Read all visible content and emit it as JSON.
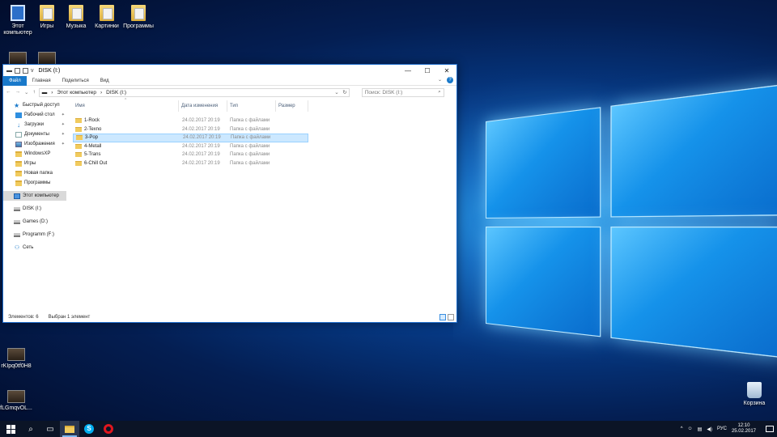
{
  "desktop": {
    "icons": [
      {
        "label": "Этот компьютер",
        "icon": "computer-icon"
      },
      {
        "label": "Игры",
        "icon": "folder-icon"
      },
      {
        "label": "Музыка",
        "icon": "folder-icon"
      },
      {
        "label": "Картинки",
        "icon": "folder-icon"
      },
      {
        "label": "Программы",
        "icon": "folder-icon"
      },
      {
        "label": "rKIpq0tf0H8",
        "icon": "image-thumbnail-icon"
      },
      {
        "label": "fLGmqvOL...",
        "icon": "image-thumbnail-icon"
      },
      {
        "label": "Корзина",
        "icon": "recycle-bin-icon"
      }
    ]
  },
  "window": {
    "title": "DISK (I:)",
    "qa_dropdown": "v",
    "controls": {
      "minimize": "—",
      "maximize": "☐",
      "close": "✕"
    },
    "ribbon_tabs": [
      "Файл",
      "Главная",
      "Поделиться",
      "Вид"
    ],
    "address": {
      "crumbs": [
        "Этот компьютер",
        "DISK (I:)"
      ],
      "separator": "›"
    },
    "search_placeholder": "Поиск: DISK (I:)",
    "sidebar": [
      {
        "label": "Быстрый доступ",
        "icon": "star-icon",
        "pinned": false
      },
      {
        "label": "Рабочий стол",
        "icon": "desktop-icon",
        "pinned": true
      },
      {
        "label": "Загрузки",
        "icon": "download-icon",
        "pinned": true
      },
      {
        "label": "Документы",
        "icon": "documents-icon",
        "pinned": true
      },
      {
        "label": "Изображения",
        "icon": "pictures-icon",
        "pinned": true
      },
      {
        "label": "WindowsXP",
        "icon": "folder-icon",
        "pinned": false
      },
      {
        "label": "Игры",
        "icon": "folder-icon",
        "pinned": false
      },
      {
        "label": "Новая папка",
        "icon": "folder-icon",
        "pinned": false
      },
      {
        "label": "Программы",
        "icon": "folder-icon",
        "pinned": false
      },
      {
        "label": "Этот компьютер",
        "icon": "computer-icon",
        "pinned": false
      },
      {
        "label": "DISK (I:)",
        "icon": "drive-icon",
        "pinned": false
      },
      {
        "label": "Games (D:)",
        "icon": "drive-icon",
        "pinned": false
      },
      {
        "label": "Programm (F:)",
        "icon": "drive-icon",
        "pinned": false
      },
      {
        "label": "Сеть",
        "icon": "network-icon",
        "pinned": false
      }
    ],
    "columns": [
      "Имя",
      "Дата изменения",
      "Тип",
      "Размер"
    ],
    "files": [
      {
        "name": "1-Rock",
        "date": "24.02.2017 20:19",
        "type": "Папка с файлами"
      },
      {
        "name": "2-Texno",
        "date": "24.02.2017 20:19",
        "type": "Папка с файлами"
      },
      {
        "name": "3-Pop",
        "date": "24.02.2017 20:19",
        "type": "Папка с файлами",
        "selected": true
      },
      {
        "name": "4-Metall",
        "date": "24.02.2017 20:19",
        "type": "Папка с файлами"
      },
      {
        "name": "5-Trans",
        "date": "24.02.2017 20:19",
        "type": "Папка с файлами"
      },
      {
        "name": "6-Chill Out",
        "date": "24.02.2017 20:19",
        "type": "Папка с файлами"
      }
    ],
    "status": {
      "count": "Элементов: 6",
      "selected": "Выбран 1 элемент"
    }
  },
  "taskbar": {
    "apps": [
      "start-icon",
      "search-icon",
      "task-view-icon",
      "file-explorer-icon",
      "skype-icon",
      "opera-icon"
    ],
    "tray": {
      "chevron": "^",
      "lang": "РУС",
      "time": "12:10",
      "date": "25.02.2017"
    }
  },
  "colors": {
    "accent": "#1979ca",
    "selection": "#cce8ff",
    "taskbar": "#0b1426"
  }
}
